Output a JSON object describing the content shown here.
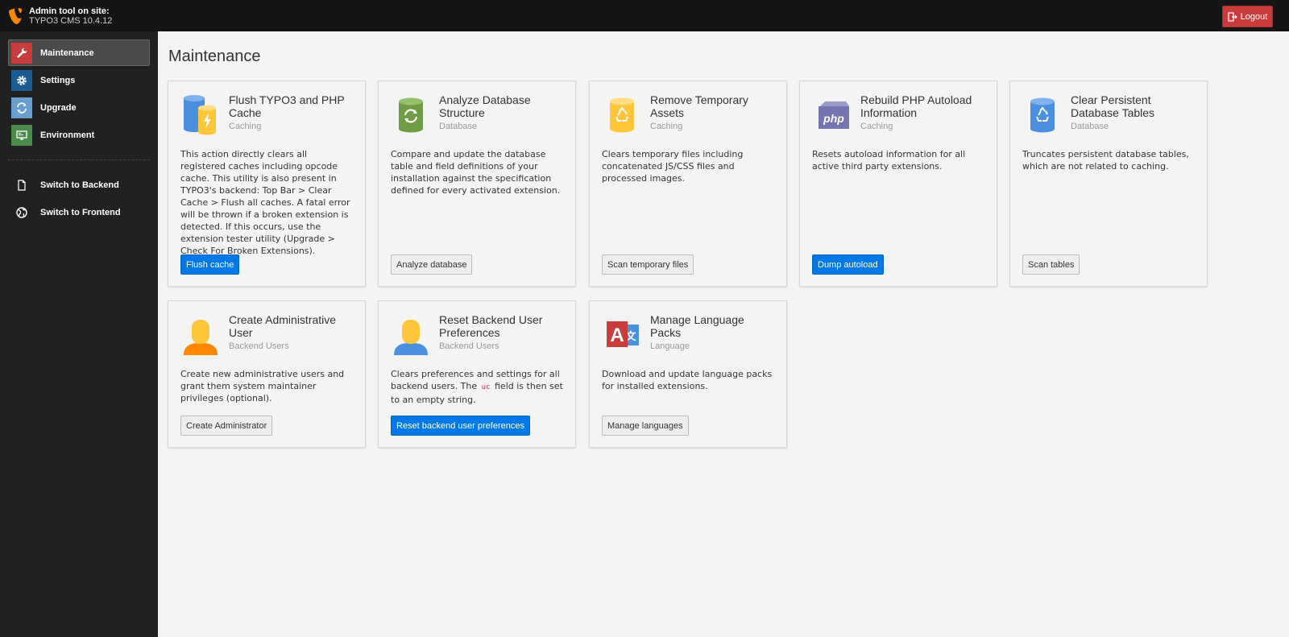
{
  "topbar": {
    "site_title": "Admin tool on site:",
    "site_version": "TYPO3 CMS 10.4.12",
    "logout_label": "Logout"
  },
  "sidebar": {
    "items": [
      {
        "label": "Maintenance",
        "icon": "wrench-icon",
        "color": "#c83c3c",
        "active": true
      },
      {
        "label": "Settings",
        "icon": "gear-icon",
        "color": "#1c5c94"
      },
      {
        "label": "Upgrade",
        "icon": "refresh-icon",
        "color": "#6a9ecf"
      },
      {
        "label": "Environment",
        "icon": "monitor-icon",
        "color": "#4a8b4a"
      }
    ],
    "links": [
      {
        "label": "Switch to Backend",
        "icon": "document-icon"
      },
      {
        "label": "Switch to Frontend",
        "icon": "globe-icon"
      }
    ]
  },
  "main": {
    "title": "Maintenance",
    "cards": [
      {
        "title": "Flush TYPO3 and PHP Cache",
        "subtitle": "Caching",
        "icon": "cache-flush-icon",
        "description": "This action directly clears all registered caches including opcode cache. This utility is also present in TYPO3's backend: Top Bar > Clear Cache > Flush all caches. A fatal error will be thrown if a broken extension is detected. If this occurs, use the extension tester utility (Upgrade > Check For Broken Extensions).",
        "button": "Flush cache",
        "primary": true
      },
      {
        "title": "Analyze Database Structure",
        "subtitle": "Database",
        "icon": "database-sync-icon",
        "description": "Compare and update the database table and field definitions of your installation against the specification defined for every activated extension.",
        "button": "Analyze database",
        "primary": false
      },
      {
        "title": "Remove Temporary Assets",
        "subtitle": "Caching",
        "icon": "database-recycle-icon",
        "description": "Clears temporary files including concatenated JS/CSS files and processed images.",
        "button": "Scan temporary files",
        "primary": false
      },
      {
        "title": "Rebuild PHP Autoload Information",
        "subtitle": "Caching",
        "icon": "php-box-icon",
        "description": "Resets autoload information for all active third party extensions.",
        "button": "Dump autoload",
        "primary": true
      },
      {
        "title": "Clear Persistent Database Tables",
        "subtitle": "Database",
        "icon": "database-recycle-blue-icon",
        "description": "Truncates persistent database tables, which are not related to caching.",
        "button": "Scan tables",
        "primary": false
      },
      {
        "title": "Create Administrative User",
        "subtitle": "Backend Users",
        "icon": "admin-user-icon",
        "description": "Create new administrative users and grant them system maintainer privileges (optional).",
        "button": "Create Administrator",
        "primary": false
      },
      {
        "title": "Reset Backend User Preferences",
        "subtitle": "Backend Users",
        "icon": "backend-user-icon",
        "description_before": "Clears preferences and settings for all backend users. The",
        "description_code": "uc",
        "description_after": "field is then set to an empty string.",
        "button": "Reset backend user preferences",
        "primary": true
      },
      {
        "title": "Manage Language Packs",
        "subtitle": "Language",
        "icon": "language-icon",
        "description": "Download and update language packs for installed extensions.",
        "button": "Manage languages",
        "primary": false
      }
    ]
  }
}
